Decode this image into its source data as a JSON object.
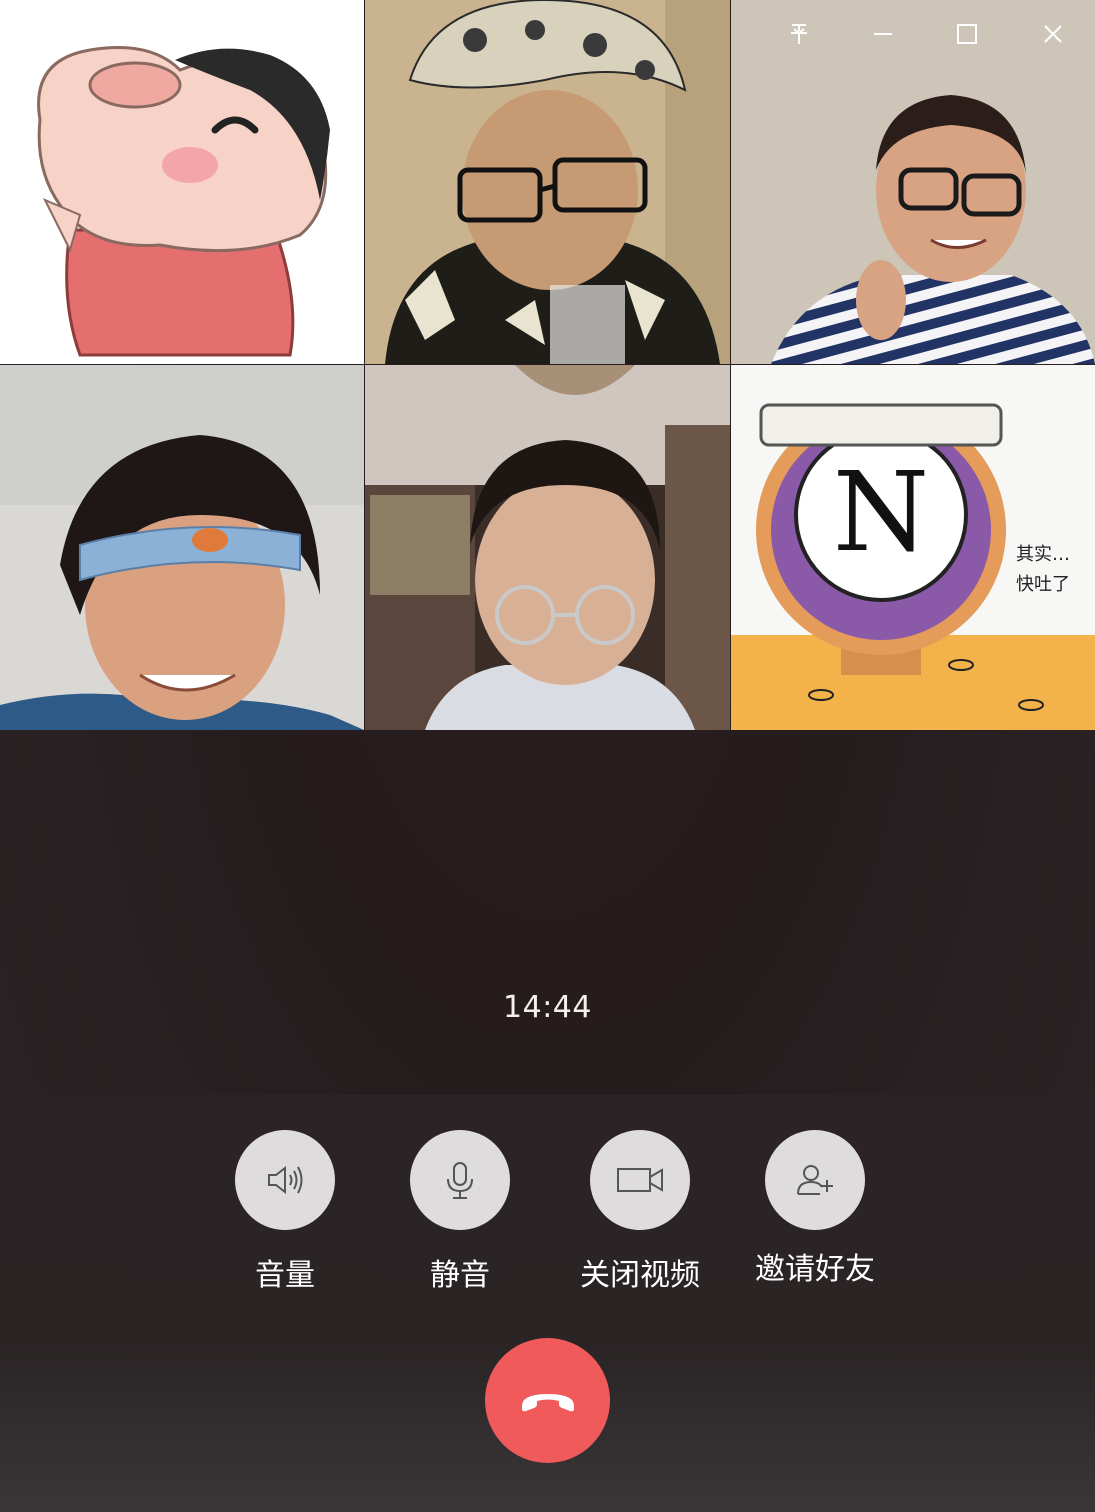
{
  "window": {
    "pin_icon": "pin-icon",
    "minimize_icon": "minimize-icon",
    "maximize_icon": "maximize-icon",
    "close_icon": "close-icon"
  },
  "participants": [
    {
      "type": "cartoon-avatar",
      "description": "crayon-shin-chan"
    },
    {
      "type": "video"
    },
    {
      "type": "video"
    },
    {
      "type": "video",
      "speaking": true
    },
    {
      "type": "video"
    },
    {
      "type": "meme-avatar",
      "caption_line1": "其实…",
      "caption_line2": "快吐了"
    }
  ],
  "call": {
    "duration": "14:44"
  },
  "controls": {
    "volume_label": "音量",
    "mute_label": "静音",
    "video_off_label": "关闭视频",
    "invite_label": "邀请好友"
  },
  "colors": {
    "hangup": "#f05a5a",
    "control_button": "#dedcdc",
    "speaking_indicator": "#1aad19"
  }
}
